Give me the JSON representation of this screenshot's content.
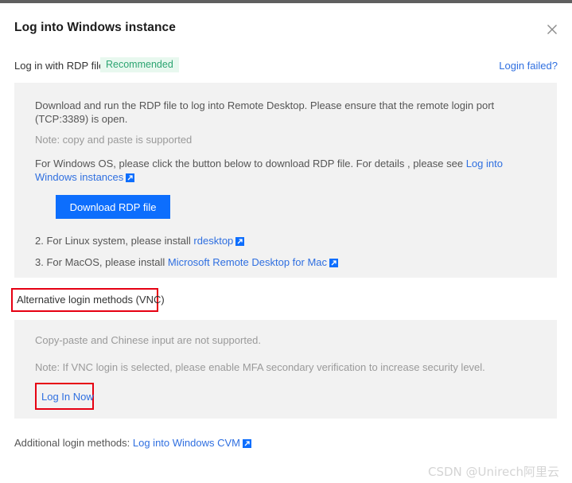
{
  "window": {
    "title": "Log into Windows instance",
    "close_icon": "close-icon"
  },
  "rdp_section": {
    "label": "Log in with RDP file",
    "badge": "Recommended",
    "login_failed_link": "Login failed?",
    "lines": {
      "intro": "Download and run the RDP file to log into Remote Desktop. Please ensure that the remote login port (TCP:3389) is open.",
      "note": "Note: copy and paste is supported",
      "windows_prefix": "For Windows OS, please click the button below to download RDP file. For details , please see ",
      "windows_link": "Log into Windows instances",
      "linux_prefix": "2. For Linux system, please install ",
      "linux_link": "rdesktop",
      "macos_prefix": "3. For MacOS, please install ",
      "macos_link": "Microsoft Remote Desktop for Mac"
    },
    "download_button": "Download RDP file"
  },
  "vnc_section": {
    "label": "Alternative login methods (VNC)",
    "lines": {
      "no_copy_paste": "Copy-paste and Chinese input are not supported.",
      "mfa_note": "Note: If VNC login is selected, please enable MFA secondary verification to increase security level."
    },
    "login_now": "Log In Now"
  },
  "footer": {
    "prefix": "Additional login methods: ",
    "link": "Log into Windows CVM"
  },
  "watermark": "CSDN @Unirech阿里云",
  "colors": {
    "accent_blue": "#0d6efd",
    "link_blue": "#2f6fe0",
    "badge_green_text": "#2ba471",
    "badge_green_bg": "#e8f8ef",
    "panel_gray": "#f2f2f2",
    "highlight_red": "#e60012"
  }
}
